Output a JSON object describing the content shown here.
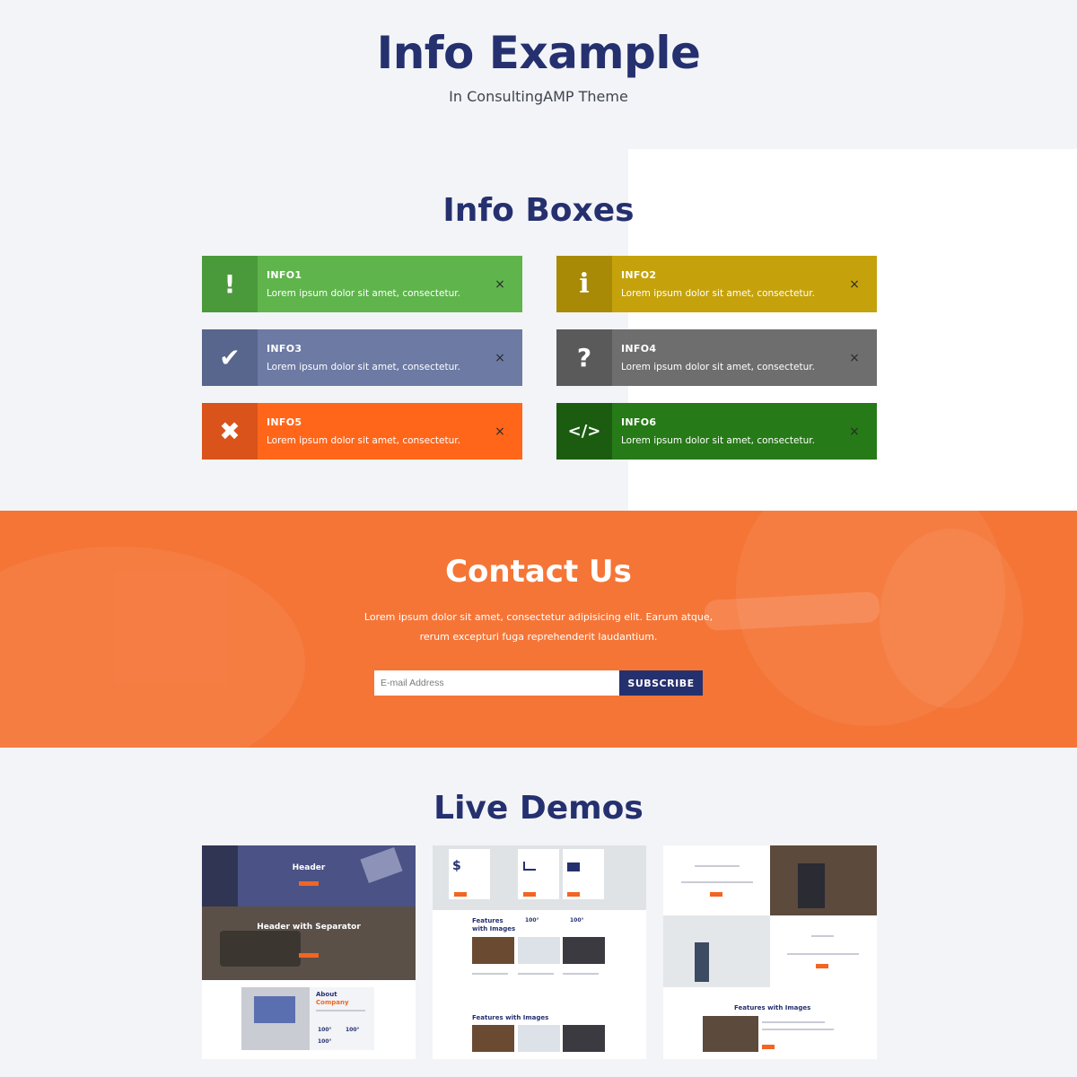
{
  "header": {
    "title": "Info Example",
    "subtitle": "In ConsultingAMP Theme"
  },
  "info_section": {
    "title": "Info Boxes",
    "boxes": [
      {
        "heading": "INFO1",
        "text": "Lorem ipsum dolor sit amet, consectetur.",
        "icon": "exclamation-icon",
        "color": "#5fb44c",
        "icon_bg": "#4a9a3b",
        "close": "×"
      },
      {
        "heading": "INFO2",
        "text": "Lorem ipsum dolor sit amet, consectetur.",
        "icon": "info-icon",
        "color": "#c5a20b",
        "icon_bg": "#a88a07",
        "close": "×"
      },
      {
        "heading": "INFO3",
        "text": "Lorem ipsum dolor sit amet, consectetur.",
        "icon": "checkmark-icon",
        "color": "#6c7aa4",
        "icon_bg": "#58658c",
        "close": "×"
      },
      {
        "heading": "INFO4",
        "text": "Lorem ipsum dolor sit amet, consectetur.",
        "icon": "question-icon",
        "color": "#6e6e6e",
        "icon_bg": "#5a5a5a",
        "close": "×"
      },
      {
        "heading": "INFO5",
        "text": "Lorem ipsum dolor sit amet, consectetur.",
        "icon": "x-mark-icon",
        "color": "#ff661a",
        "icon_bg": "#d9531a",
        "close": "×"
      },
      {
        "heading": "INFO6",
        "text": "Lorem ipsum dolor sit amet, consectetur.",
        "icon": "code-icon",
        "color": "#267a17",
        "icon_bg": "#1b5c10",
        "close": "×"
      }
    ]
  },
  "contact": {
    "title": "Contact Us",
    "text": "Lorem ipsum dolor sit amet, consectetur adipisicing elit. Earum atque, rerum excepturi fuga reprehenderit laudantium.",
    "email_placeholder": "E-mail Address",
    "subscribe_label": "SUBSCRIBE",
    "accent": "#f57537"
  },
  "demos": {
    "title": "Live Demos",
    "card1": {
      "label_a": "Header",
      "label_b": "Header with Separator",
      "label_c": "About",
      "label_d": "Company",
      "stat_a": "100°",
      "stat_b": "100°",
      "stat_c": "100°"
    },
    "card2": {
      "label_a": "Features",
      "label_b": "with Images",
      "stat_a": "100°",
      "stat_b": "100°",
      "label_c": "Features with Images"
    },
    "card3": {
      "label_a": "Features with Images"
    }
  },
  "colors": {
    "navy": "#25306f",
    "background": "#f3f4f7"
  }
}
